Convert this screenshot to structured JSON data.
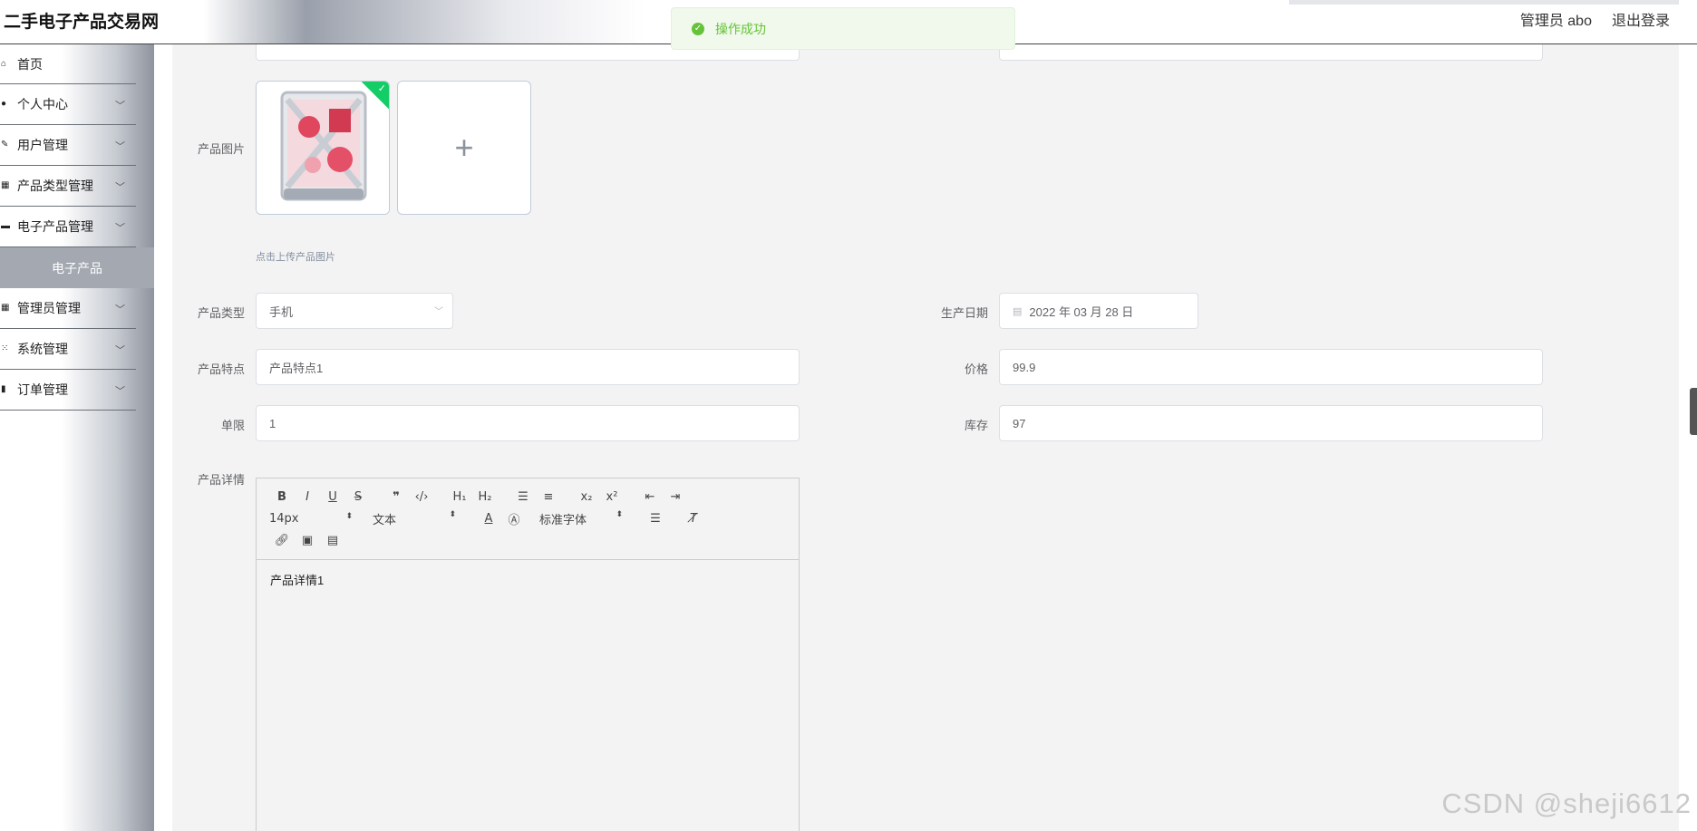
{
  "app": {
    "title": "二手电子产品交易网"
  },
  "header": {
    "admin_label": "管理员 abo",
    "logout_label": "退出登录"
  },
  "toast": {
    "message": "操作成功",
    "icon": "check-circle-icon",
    "color": "#67c23a"
  },
  "sidebar": {
    "items": [
      {
        "label": "首页",
        "icon": "home-icon"
      },
      {
        "label": "个人中心",
        "icon": "user-icon"
      },
      {
        "label": "用户管理",
        "icon": "edit-icon"
      },
      {
        "label": "产品类型管理",
        "icon": "grid-icon"
      },
      {
        "label": "电子产品管理",
        "icon": "monitor-icon"
      },
      {
        "label": "电子产品",
        "icon": "",
        "selected": true
      },
      {
        "label": "管理员管理",
        "icon": "grid-icon"
      },
      {
        "label": "系统管理",
        "icon": "apps-icon"
      },
      {
        "label": "订单管理",
        "icon": "bar-chart-icon"
      }
    ]
  },
  "form": {
    "product_image": {
      "label": "产品图片",
      "upload_tip": "点击上传产品图片"
    },
    "product_type": {
      "label": "产品类型",
      "value": "手机"
    },
    "production_date": {
      "label": "生产日期",
      "value": "2022 年 03 月 28 日"
    },
    "product_feature": {
      "label": "产品特点",
      "value": "产品特点1"
    },
    "price": {
      "label": "价格",
      "value": "99.9"
    },
    "limit": {
      "label": "单限",
      "value": "1"
    },
    "stock": {
      "label": "库存",
      "value": "97"
    },
    "detail": {
      "label": "产品详情",
      "font_size": "14px",
      "header_select": "文本",
      "font_family": "标准字体",
      "content": "产品详情1"
    }
  },
  "watermark": "CSDN @sheji6612"
}
